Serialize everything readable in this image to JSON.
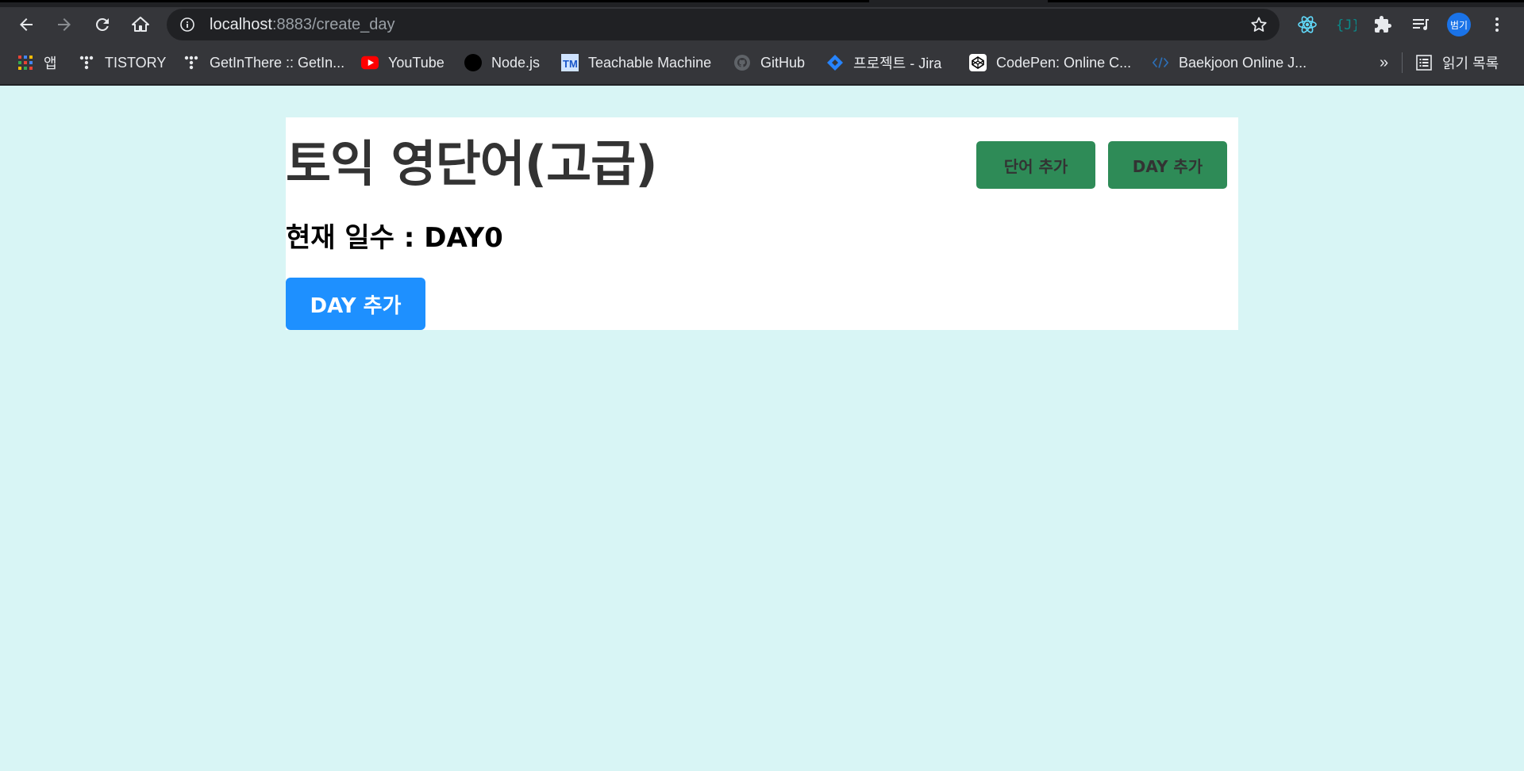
{
  "browser": {
    "url_host": "localhost",
    "url_path": ":8883/create_day",
    "avatar_label": "범기",
    "bookmarks": [
      {
        "label": "앱",
        "icon": "apps-grid-icon"
      },
      {
        "label": "TISTORY",
        "icon": "tistory-icon"
      },
      {
        "label": "GetInThere :: GetIn...",
        "icon": "getinthere-icon"
      },
      {
        "label": "YouTube",
        "icon": "youtube-icon"
      },
      {
        "label": "Node.js",
        "icon": "nodejs-icon"
      },
      {
        "label": "Teachable Machine",
        "icon": "teachable-machine-icon"
      },
      {
        "label": "GitHub",
        "icon": "github-icon"
      },
      {
        "label": "프로젝트 - Jira",
        "icon": "jira-icon"
      },
      {
        "label": "CodePen: Online C...",
        "icon": "codepen-icon"
      },
      {
        "label": "Baekjoon Online J...",
        "icon": "baekjoon-icon"
      }
    ],
    "overflow_label": "»",
    "reading_list_label": "읽기 목록"
  },
  "header": {
    "title": "토익 영단어(고급)",
    "menu": {
      "add_word_label": "단어 추가",
      "add_day_label": "DAY 추가"
    }
  },
  "main": {
    "current_day_text": "현재 일수 : DAY0",
    "add_day_button_label": "DAY 추가"
  },
  "colors": {
    "page_background": "#d8f5f5",
    "menu_button": "#2e8b57",
    "primary_button": "#1e90ff",
    "title_text": "#333333"
  }
}
